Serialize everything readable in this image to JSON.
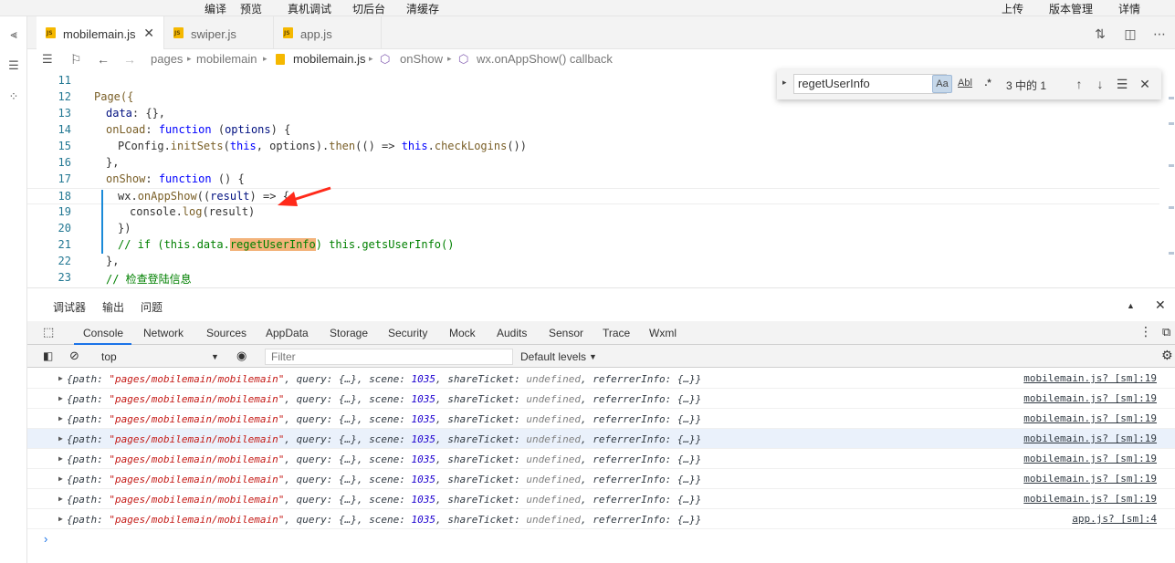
{
  "menubar": {
    "left": [
      "编译",
      "预览",
      "真机调试",
      "切后台",
      "清缓存"
    ],
    "right": [
      "上传",
      "版本管理",
      "详情"
    ]
  },
  "tabs": [
    {
      "label": "mobilemain.js",
      "close": "✕"
    },
    {
      "label": "swiper.js"
    },
    {
      "label": "app.js"
    }
  ],
  "breadcrumb": [
    "pages",
    "mobilemain",
    "mobilemain.js",
    "onShow",
    "wx.onAppShow() callback"
  ],
  "editor": {
    "lines": [
      {
        "n": "11"
      },
      {
        "n": "12"
      },
      {
        "n": "13"
      },
      {
        "n": "14"
      },
      {
        "n": "15"
      },
      {
        "n": "16"
      },
      {
        "n": "17"
      },
      {
        "n": "18"
      },
      {
        "n": "19"
      },
      {
        "n": "20"
      },
      {
        "n": "21"
      },
      {
        "n": "22"
      },
      {
        "n": "23"
      }
    ],
    "l12": "Page({",
    "l13_a": "data",
    "l13_b": ": {},",
    "l14_a": "onLoad",
    "l14_b": ": ",
    "l14_c": "function",
    "l14_d": " (",
    "l14_e": "options",
    "l14_f": ") {",
    "l15_a": "PConfig.",
    "l15_b": "initSets",
    "l15_c": "(",
    "l15_d": "this",
    "l15_e": ", options).",
    "l15_f": "then",
    "l15_g": "(() => ",
    "l15_h": "this",
    "l15_i": ".",
    "l15_j": "checkLogins",
    "l15_k": "())",
    "l16": "},",
    "l17_a": "onShow",
    "l17_b": ": ",
    "l17_c": "function",
    "l17_d": " () {",
    "l18_a": "wx.",
    "l18_b": "onAppShow",
    "l18_c": "((",
    "l18_d": "result",
    "l18_e": ") => {",
    "l19_a": "console.",
    "l19_b": "log",
    "l19_c": "(result)",
    "l20": "})",
    "l21_a": "// if (this.data.",
    "l21_b": "regetUserInfo",
    "l21_c": ") this.getsUserInfo()",
    "l22": "},",
    "l23": "// 检查登陆信息"
  },
  "find": {
    "value": "regetUserInfo",
    "case_label": "Aa",
    "word_label": "Abl",
    "regex_label": ".*",
    "count": "3 中的 1"
  },
  "panel": {
    "tabs": [
      "调试器",
      "输出",
      "问题"
    ],
    "devtabs": [
      "Console",
      "Network",
      "Sources",
      "AppData",
      "Storage",
      "Security",
      "Mock",
      "Audits",
      "Sensor",
      "Trace",
      "Wxml"
    ],
    "context": "top",
    "filter_placeholder": "Filter",
    "levels": "Default levels"
  },
  "logs": [
    {
      "path": "\"pages/mobilemain/mobilemain\"",
      "scene": "1035",
      "src": "mobilemain.js? [sm]:19"
    },
    {
      "path": "\"pages/mobilemain/mobilemain\"",
      "scene": "1035",
      "src": "mobilemain.js? [sm]:19"
    },
    {
      "path": "\"pages/mobilemain/mobilemain\"",
      "scene": "1035",
      "src": "mobilemain.js? [sm]:19"
    },
    {
      "path": "\"pages/mobilemain/mobilemain\"",
      "scene": "1035",
      "src": "mobilemain.js? [sm]:19"
    },
    {
      "path": "\"pages/mobilemain/mobilemain\"",
      "scene": "1035",
      "src": "mobilemain.js? [sm]:19"
    },
    {
      "path": "\"pages/mobilemain/mobilemain\"",
      "scene": "1035",
      "src": "mobilemain.js? [sm]:19"
    },
    {
      "path": "\"pages/mobilemain/mobilemain\"",
      "scene": "1035",
      "src": "mobilemain.js? [sm]:19"
    },
    {
      "path": "\"pages/mobilemain/mobilemain\"",
      "scene": "1035",
      "src": "app.js? [sm]:4"
    }
  ],
  "log_parts": {
    "open": "{path: ",
    "query": ", query: {…}, scene: ",
    "share": ", shareTicket: ",
    "undef": "undefined",
    "ref": ", referrerInfo: {…}}"
  },
  "icons": [
    "split-editor-icon",
    "compare-icon",
    "more-icon",
    "explorer-icon",
    "debug-icon",
    "list-icon",
    "bookmark-icon",
    "back-icon",
    "forward-icon",
    "js-file-icon",
    "method-icon",
    "inspect-icon",
    "sidebar-toggle-icon",
    "clear-icon",
    "eye-icon",
    "settings-icon",
    "arrow-up-icon",
    "arrow-down-icon",
    "selection-icon",
    "close-icon",
    "annotation-arrow-icon"
  ],
  "colors": {
    "accent": "#1a73e8",
    "annotation": "#ff2a1a",
    "find_highlight": "#f3b37a"
  }
}
